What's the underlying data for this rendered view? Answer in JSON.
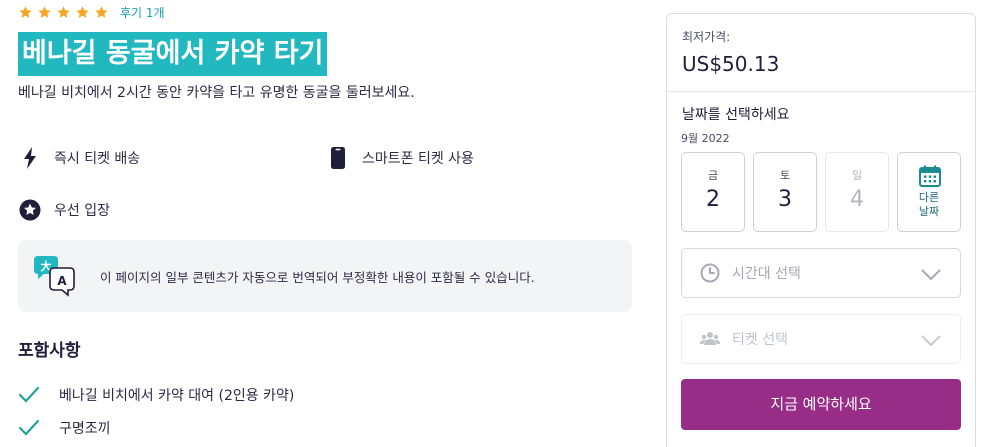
{
  "product": {
    "rating": 5,
    "review_count_label": "후기 1개",
    "title": "베나길 동굴에서 카약 타기",
    "subtitle": "베나길 비치에서 2시간 동안 카약을 타고 유명한 동굴을 둘러보세요."
  },
  "features": [
    {
      "icon": "lightning-icon",
      "label": "즉시 티켓 배송"
    },
    {
      "icon": "smartphone-icon",
      "label": "스마트폰 티켓 사용"
    },
    {
      "icon": "star-badge-icon",
      "label": "우선 입장"
    }
  ],
  "notice": {
    "icon": "translate-icon",
    "text": "이 페이지의 일부 콘텐츠가 자동으로 번역되어 부정확한 내용이 포함될 수 있습니다."
  },
  "included": {
    "title": "포함사항",
    "items": [
      "베나길 비치에서 카약 대여 (2인용 카약)",
      "구명조끼"
    ]
  },
  "booking": {
    "price_label": "최저가격:",
    "price": "US$50.13",
    "date_title": "날짜를 선택하세요",
    "month": "9월 2022",
    "days": [
      {
        "dow": "금",
        "num": "2",
        "disabled": false
      },
      {
        "dow": "토",
        "num": "3",
        "disabled": false
      },
      {
        "dow": "일",
        "num": "4",
        "disabled": true
      }
    ],
    "other_dates_line1": "다른",
    "other_dates_line2": "날짜",
    "time_select_placeholder": "시간대 선택",
    "ticket_select_placeholder": "티켓 선택",
    "book_button": "지금 예약하세요"
  },
  "colors": {
    "accent_teal": "#22b8bf",
    "star": "#f5a623",
    "book_button": "#972d87",
    "check": "#22a39a"
  }
}
